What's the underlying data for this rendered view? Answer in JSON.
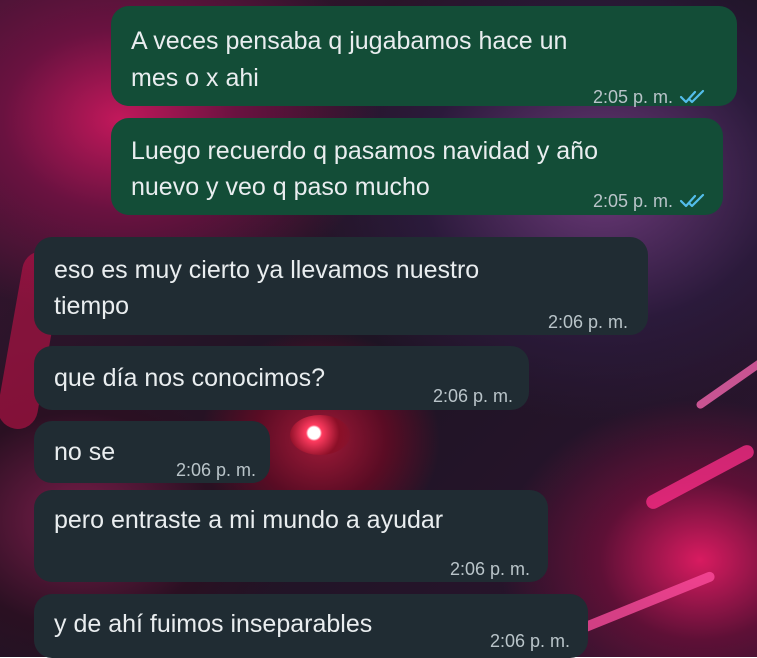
{
  "chat": {
    "messages": [
      {
        "direction": "outgoing",
        "lines": [
          "A veces pensaba q jugabamos hace un",
          "mes o x ahi"
        ],
        "time": "2:05 p. m.",
        "status": "read"
      },
      {
        "direction": "outgoing",
        "lines": [
          "Luego recuerdo q pasamos navidad y año",
          "nuevo y veo q paso mucho"
        ],
        "time": "2:05 p. m.",
        "status": "read"
      },
      {
        "direction": "incoming",
        "lines": [
          "eso es muy cierto ya llevamos nuestro",
          "tiempo"
        ],
        "time": "2:06 p. m."
      },
      {
        "direction": "incoming",
        "lines": [
          "que día nos conocimos?"
        ],
        "time": "2:06 p. m."
      },
      {
        "direction": "incoming",
        "lines": [
          "no se"
        ],
        "time": "2:06 p. m."
      },
      {
        "direction": "incoming",
        "lines": [
          "pero entraste a mi mundo a ayudar"
        ],
        "time": "2:06 p. m."
      },
      {
        "direction": "incoming",
        "lines": [
          "y de ahí fuimos inseparables"
        ],
        "time": "2:06 p. m."
      }
    ]
  },
  "colors": {
    "outgoing_bubble": "#134d37",
    "incoming_bubble": "#202c33",
    "read_tick": "#53bdeb"
  },
  "icons": {
    "read_receipt": "double-check-icon"
  }
}
